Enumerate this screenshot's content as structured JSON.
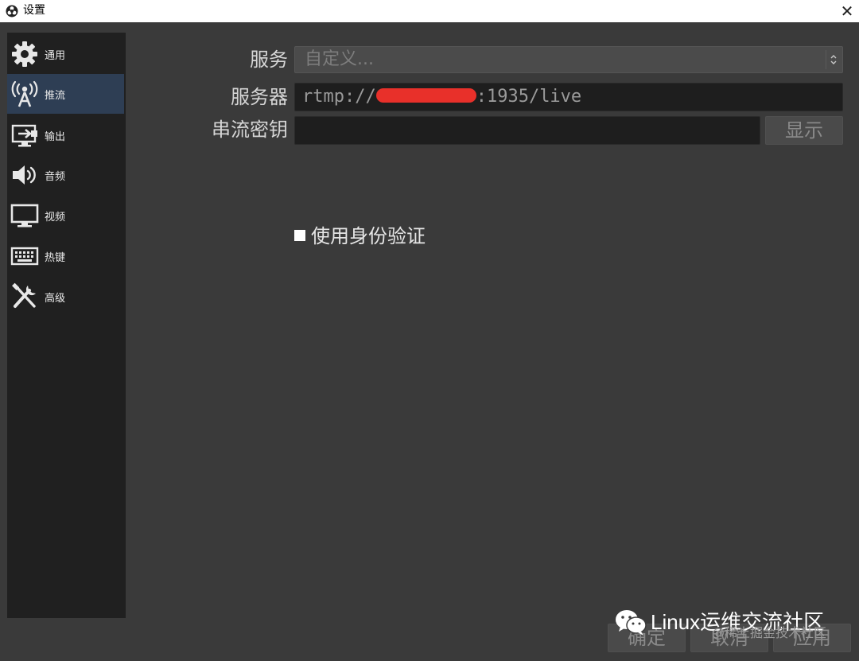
{
  "window": {
    "title": "设置",
    "close_glyph": "✕"
  },
  "sidebar": {
    "items": [
      {
        "label": "通用",
        "icon": "gear-icon",
        "active": false
      },
      {
        "label": "推流",
        "icon": "broadcast-antenna-icon",
        "active": true
      },
      {
        "label": "输出",
        "icon": "output-monitor-icon",
        "active": false
      },
      {
        "label": "音频",
        "icon": "speaker-icon",
        "active": false
      },
      {
        "label": "视频",
        "icon": "monitor-icon",
        "active": false
      },
      {
        "label": "热键",
        "icon": "keyboard-icon",
        "active": false
      },
      {
        "label": "高级",
        "icon": "tools-icon",
        "active": false
      }
    ]
  },
  "form": {
    "service_label": "服务",
    "service_value": "自定义...",
    "server_label": "服务器",
    "server_value_prefix": "rtmp://",
    "server_value_suffix": ":1935/live",
    "stream_key_label": "串流密钥",
    "stream_key_value": "",
    "show_button": "显示",
    "auth_checkbox_label": "使用身份验证"
  },
  "footer": {
    "ok_button": "确定",
    "cancel_button": "取消",
    "apply_button": "应用"
  },
  "watermark": {
    "main": "Linux运维交流社区",
    "sub": "@稀土掘金技术社区"
  },
  "colors": {
    "background": "#3a3a3a",
    "sidebar": "#202020",
    "active_item": "#2e3e54",
    "redaction": "#e8302a"
  }
}
